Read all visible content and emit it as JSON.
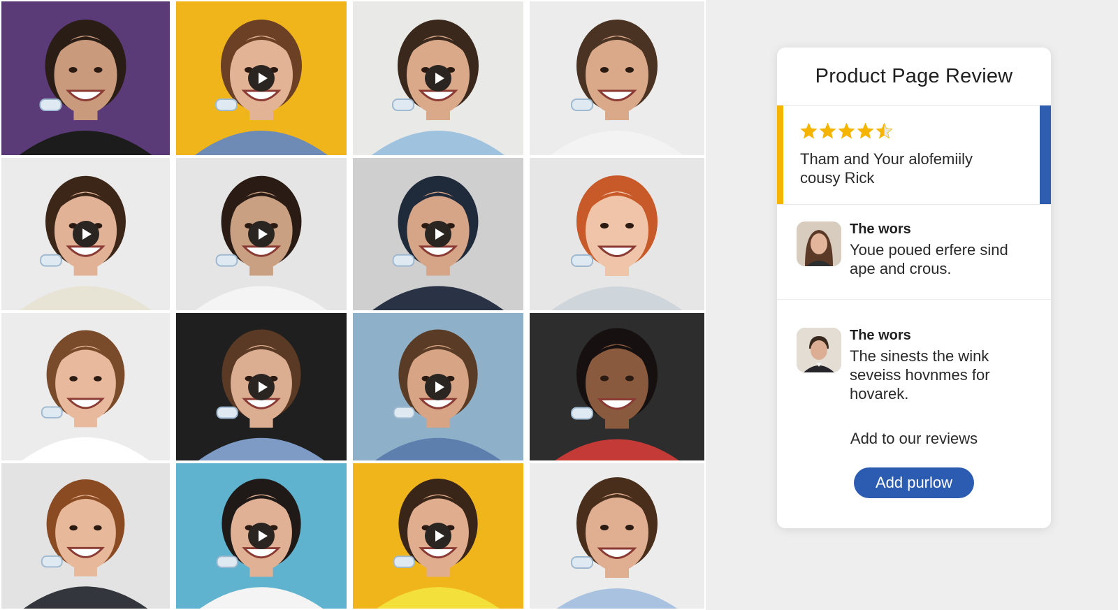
{
  "grid": {
    "tiles": [
      {
        "bg": "#5b3a78",
        "skin": "#c99a7c",
        "hair": "#2a1d16",
        "shirt": "#1c1c1c",
        "play": false
      },
      {
        "bg": "#f1b51c",
        "skin": "#e3b395",
        "hair": "#6b4024",
        "shirt": "#6d8bb5",
        "play": true
      },
      {
        "bg": "#e9e9e7",
        "skin": "#d9a98a",
        "hair": "#3a281c",
        "shirt": "#9fc3de",
        "play": true
      },
      {
        "bg": "#ececec",
        "skin": "#d9a98a",
        "hair": "#4a3322",
        "shirt": "#f3f3f3",
        "play": false
      },
      {
        "bg": "#ebebeb",
        "skin": "#e1b296",
        "hair": "#3b2618",
        "shirt": "#e7e3d5",
        "play": true
      },
      {
        "bg": "#e5e5e5",
        "skin": "#caa083",
        "hair": "#2a1c14",
        "shirt": "#f4f4f4",
        "play": true
      },
      {
        "bg": "#cfcfcf",
        "skin": "#d6a487",
        "hair": "#1f2a3a",
        "shirt": "#2a3346",
        "play": true
      },
      {
        "bg": "#e6e6e6",
        "skin": "#f0c4a8",
        "hair": "#c85a2a",
        "shirt": "#cfd6db",
        "play": false
      },
      {
        "bg": "#ececec",
        "skin": "#e8b99c",
        "hair": "#7a4b2b",
        "shirt": "#ffffff",
        "play": false
      },
      {
        "bg": "#1f1f1f",
        "skin": "#dcae91",
        "hair": "#5a3a24",
        "shirt": "#7d9bc4",
        "play": true
      },
      {
        "bg": "#8fb0c9",
        "skin": "#d7a585",
        "hair": "#5a3c26",
        "shirt": "#5c7fae",
        "play": true
      },
      {
        "bg": "#2d2d2d",
        "skin": "#8a5a3f",
        "hair": "#161010",
        "shirt": "#c43a36",
        "play": false
      },
      {
        "bg": "#e3e3e3",
        "skin": "#e7b899",
        "hair": "#8a4a22",
        "shirt": "#33363d",
        "play": false
      },
      {
        "bg": "#5fb3cf",
        "skin": "#e1b195",
        "hair": "#1f1a18",
        "shirt": "#f4f4f4",
        "play": true
      },
      {
        "bg": "#f1b51c",
        "skin": "#e0ad8e",
        "hair": "#3a2618",
        "shirt": "#f3e03a",
        "play": true
      },
      {
        "bg": "#ececec",
        "skin": "#e0ae90",
        "hair": "#4a2e1c",
        "shirt": "#a8c2df",
        "play": false
      }
    ]
  },
  "card": {
    "title": "Product Page Review",
    "featured": {
      "rating": 4.5,
      "star_color": "#f4b400",
      "text_line1": "Tham and Your alofemiily",
      "text_line2": "cousy Rick"
    },
    "reviews": [
      {
        "name": "The wors",
        "line1": "Youe poued erfere sind",
        "line2": "ape and crous.",
        "line3": ""
      },
      {
        "name": "The wors",
        "line1": "The sinests the wink",
        "line2": "seveiss hovnmes for",
        "line3": "hovarek."
      }
    ],
    "add_reviews_label": "Add to our reviews",
    "add_button_label": "Add purlow",
    "accent_colors": {
      "yellow": "#f4b400",
      "blue": "#2f5db0",
      "button": "#2c5cb1"
    }
  }
}
